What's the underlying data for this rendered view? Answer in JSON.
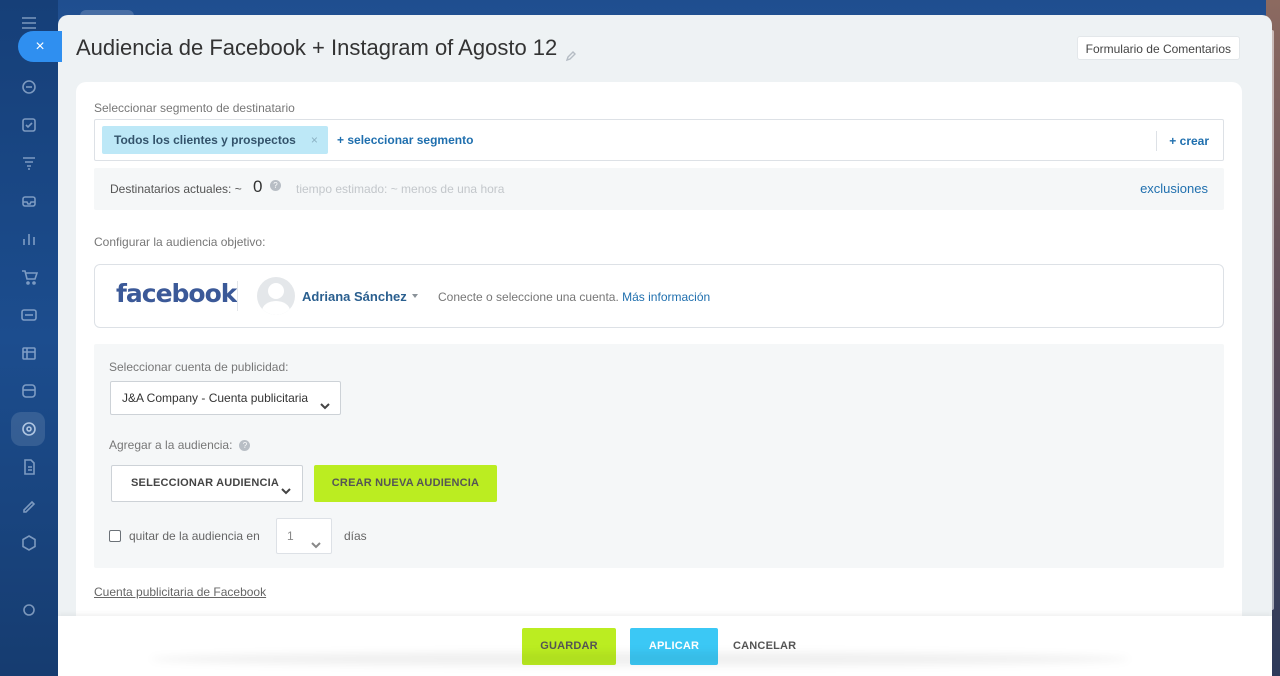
{
  "panel": {
    "title": "Audiencia de Facebook + Instagram of Agosto 12",
    "feedback_button": "Formulario de Comentarios"
  },
  "segment": {
    "label": "Seleccionar segmento de destinatario",
    "selected_tag": "Todos los clientes y prospectos",
    "tag_remove": "×",
    "add_segment": "+ seleccionar segmento",
    "create": "+ crear"
  },
  "recipients": {
    "label": "Destinatarios actuales: ~",
    "count": "0",
    "help": "?",
    "estimate": "tiempo estimado: ~ menos de una hora",
    "exclusions": "exclusiones"
  },
  "audience": {
    "label": "Configurar la audiencia objetivo:",
    "facebook_logo": "facebook",
    "user_name": "Adriana Sánchez",
    "hint": "Conecte o seleccione una cuenta.",
    "more_info": "Más información"
  },
  "settings": {
    "ad_account_label": "Seleccionar cuenta de publicidad:",
    "ad_account_value": "J&A Company - Cuenta publicitaria",
    "add_to_audience_label": "Agregar a la audiencia:",
    "help": "?",
    "select_audience": "SELECCIONAR AUDIENCIA",
    "create_audience": "CREAR NUEVA AUDIENCIA",
    "remove_label": "quitar de la audiencia en",
    "days_value": "1",
    "days_word": "días",
    "remove_checked": false
  },
  "fb_account_link": "Cuenta publicitaria de Facebook",
  "footer": {
    "save": "GUARDAR",
    "apply": "APLICAR",
    "cancel": "CANCELAR"
  },
  "close_symbol": "×",
  "colors": {
    "accent_green": "#bbed21",
    "accent_blue": "#3bc8f5",
    "link_blue": "#1f6fae",
    "facebook_blue": "#3b5998"
  }
}
